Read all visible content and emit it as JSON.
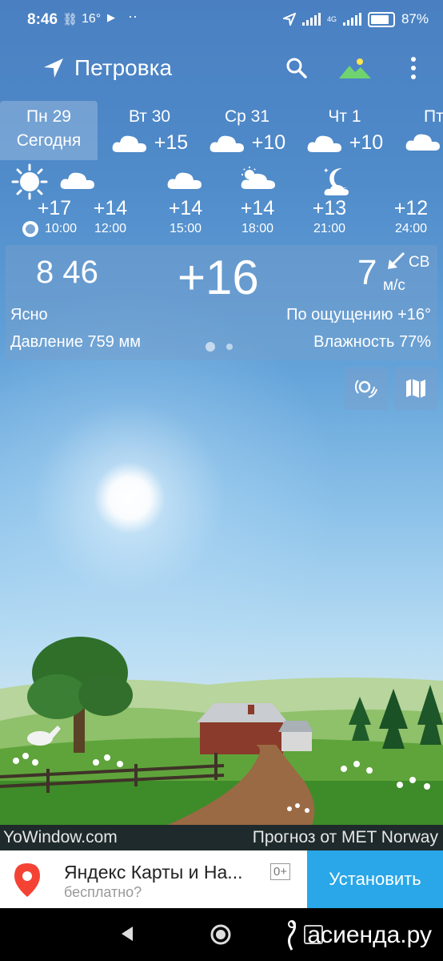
{
  "status_bar": {
    "time": "8:46",
    "temp": "16°",
    "network": "4G",
    "battery": "87%"
  },
  "app_bar": {
    "location": "Петровка"
  },
  "days": [
    {
      "name": "Пн 29",
      "sub": "Сегодня",
      "temp": "",
      "selected": true
    },
    {
      "name": "Вт 30",
      "temp": "+15"
    },
    {
      "name": "Ср 31",
      "temp": "+10"
    },
    {
      "name": "Чт 1",
      "temp": "+10"
    },
    {
      "name": "Пт",
      "temp": ""
    }
  ],
  "hourly": [
    {
      "temp": "+17",
      "time": "10:00",
      "icon": "sun-icon"
    },
    {
      "temp": "+14",
      "time": "12:00",
      "icon": "cloud-icon"
    },
    {
      "temp": "+14",
      "time": "15:00",
      "icon": "cloud-icon"
    },
    {
      "temp": "+14",
      "time": "18:00",
      "icon": "partly-cloudy-icon"
    },
    {
      "temp": "+13",
      "time": "21:00",
      "icon": "moon-cloud-icon"
    },
    {
      "temp": "+12",
      "time": "24:00",
      "icon": ""
    }
  ],
  "current": {
    "time": "8 46",
    "temperature": "+16",
    "wind_speed": "7",
    "wind_dir": "СВ",
    "wind_unit": "м/с",
    "condition": "Ясно",
    "feels_like": "По ощущению +16°",
    "pressure": "Давление 759 мм",
    "humidity": "Влажность 77%"
  },
  "footer": {
    "left": "YoWindow.com",
    "right": "Прогноз от MET Norway"
  },
  "ad": {
    "title": "Яндекс Карты и На...",
    "subtitle": "бесплатно?",
    "age": "0+",
    "install": "Установить"
  },
  "watermark": "асиенда.ру"
}
